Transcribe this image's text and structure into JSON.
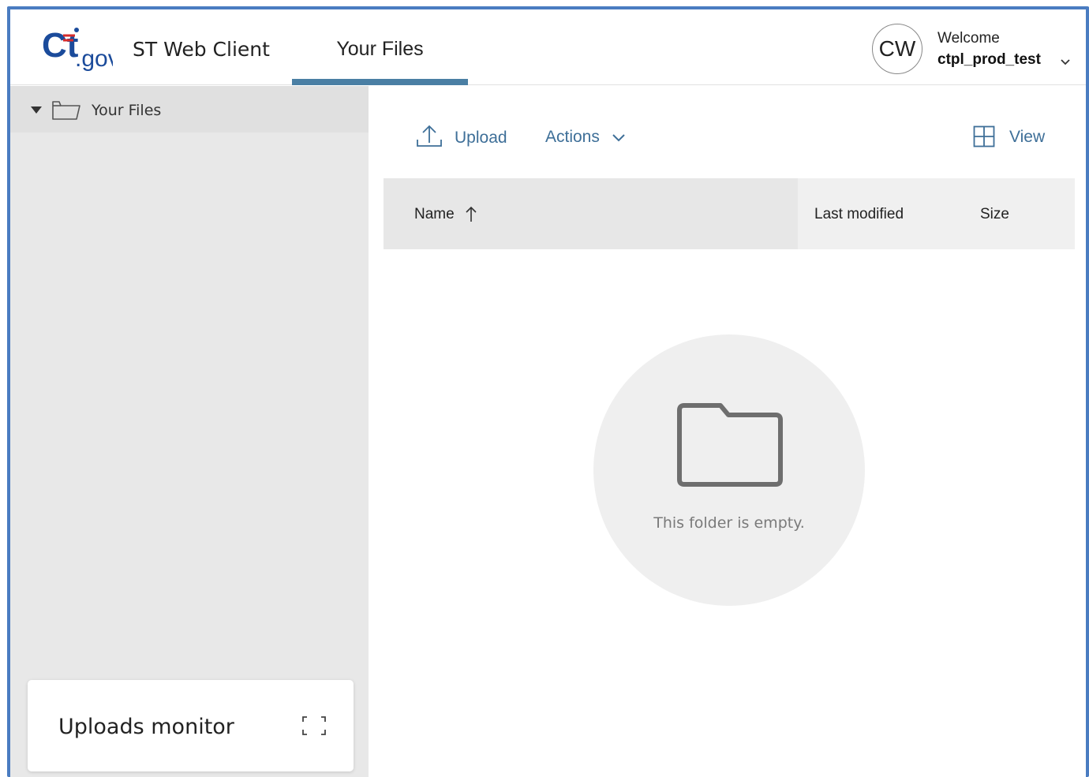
{
  "header": {
    "logo_text": "Ct.gov",
    "app_title": "ST Web Client",
    "nav_tab": "Your Files",
    "avatar_initials": "CW",
    "welcome": "Welcome",
    "username": "ctpl_prod_test"
  },
  "sidebar": {
    "tree_root": "Your Files",
    "uploads_monitor_title": "Uploads monitor"
  },
  "toolbar": {
    "upload_label": "Upload",
    "actions_label": "Actions",
    "view_label": "View"
  },
  "table": {
    "columns": [
      "Name",
      "Last modified",
      "Size"
    ],
    "sort_column": "Name",
    "sort_direction": "ascending"
  },
  "empty_state": {
    "message": "This folder is empty."
  },
  "icons": {
    "upload": "upload-icon",
    "actions_dropdown": "chevron-down-icon",
    "view": "grid-view-icon",
    "sort": "arrow-up-icon",
    "tree_caret": "caret-down-icon",
    "tree_folder": "folder-icon",
    "expand": "expand-icon",
    "empty_folder": "folder-icon"
  },
  "colors": {
    "frame_border": "#4a7cc1",
    "accent": "#3e6f98",
    "tab_underline": "#4a7fa4",
    "sidebar_bg": "#e8e8e8",
    "logo_blue": "#1b4b9b",
    "logo_red": "#d62b2b"
  }
}
